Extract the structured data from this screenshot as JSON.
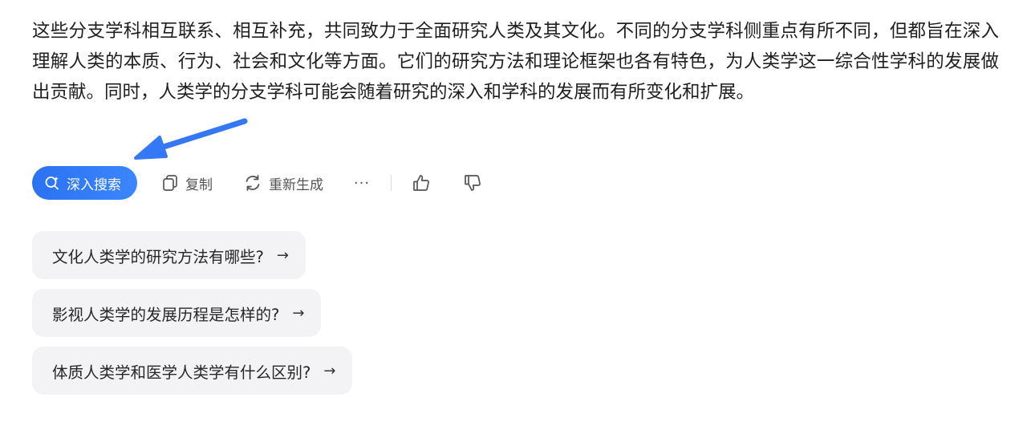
{
  "answer": {
    "paragraph": "这些分支学科相互联系、相互补充，共同致力于全面研究人类及其文化。不同的分支学科侧重点有所不同，但都旨在深入理解人类的本质、行为、社会和文化等方面。它们的研究方法和理论框架也各有特色，为人类学这一综合性学科的发展做出贡献。同时，人类学的分支学科可能会随着研究的深入和学科的发展而有所变化和扩展。"
  },
  "actions": {
    "deep_search_label": "深入搜索",
    "copy_label": "复制",
    "regenerate_label": "重新生成",
    "more_label": "···"
  },
  "suggestions": [
    {
      "text": "文化人类学的研究方法有哪些?",
      "arrow": "→"
    },
    {
      "text": "影视人类学的发展历程是怎样的?",
      "arrow": "→"
    },
    {
      "text": "体质人类学和医学人类学有什么区别?",
      "arrow": "→"
    }
  ],
  "icons": {
    "deep_search": "search-sparkle-icon",
    "copy": "copy-icon",
    "regenerate": "refresh-icon",
    "more": "more-dots-icon",
    "thumb_up": "thumb-up-icon",
    "thumb_down": "thumb-down-icon",
    "annotation": "annotation-arrow"
  },
  "colors": {
    "accent": "#2b72f2",
    "annotation_arrow": "#3478f6",
    "suggestion_bg": "#f3f3f5"
  }
}
